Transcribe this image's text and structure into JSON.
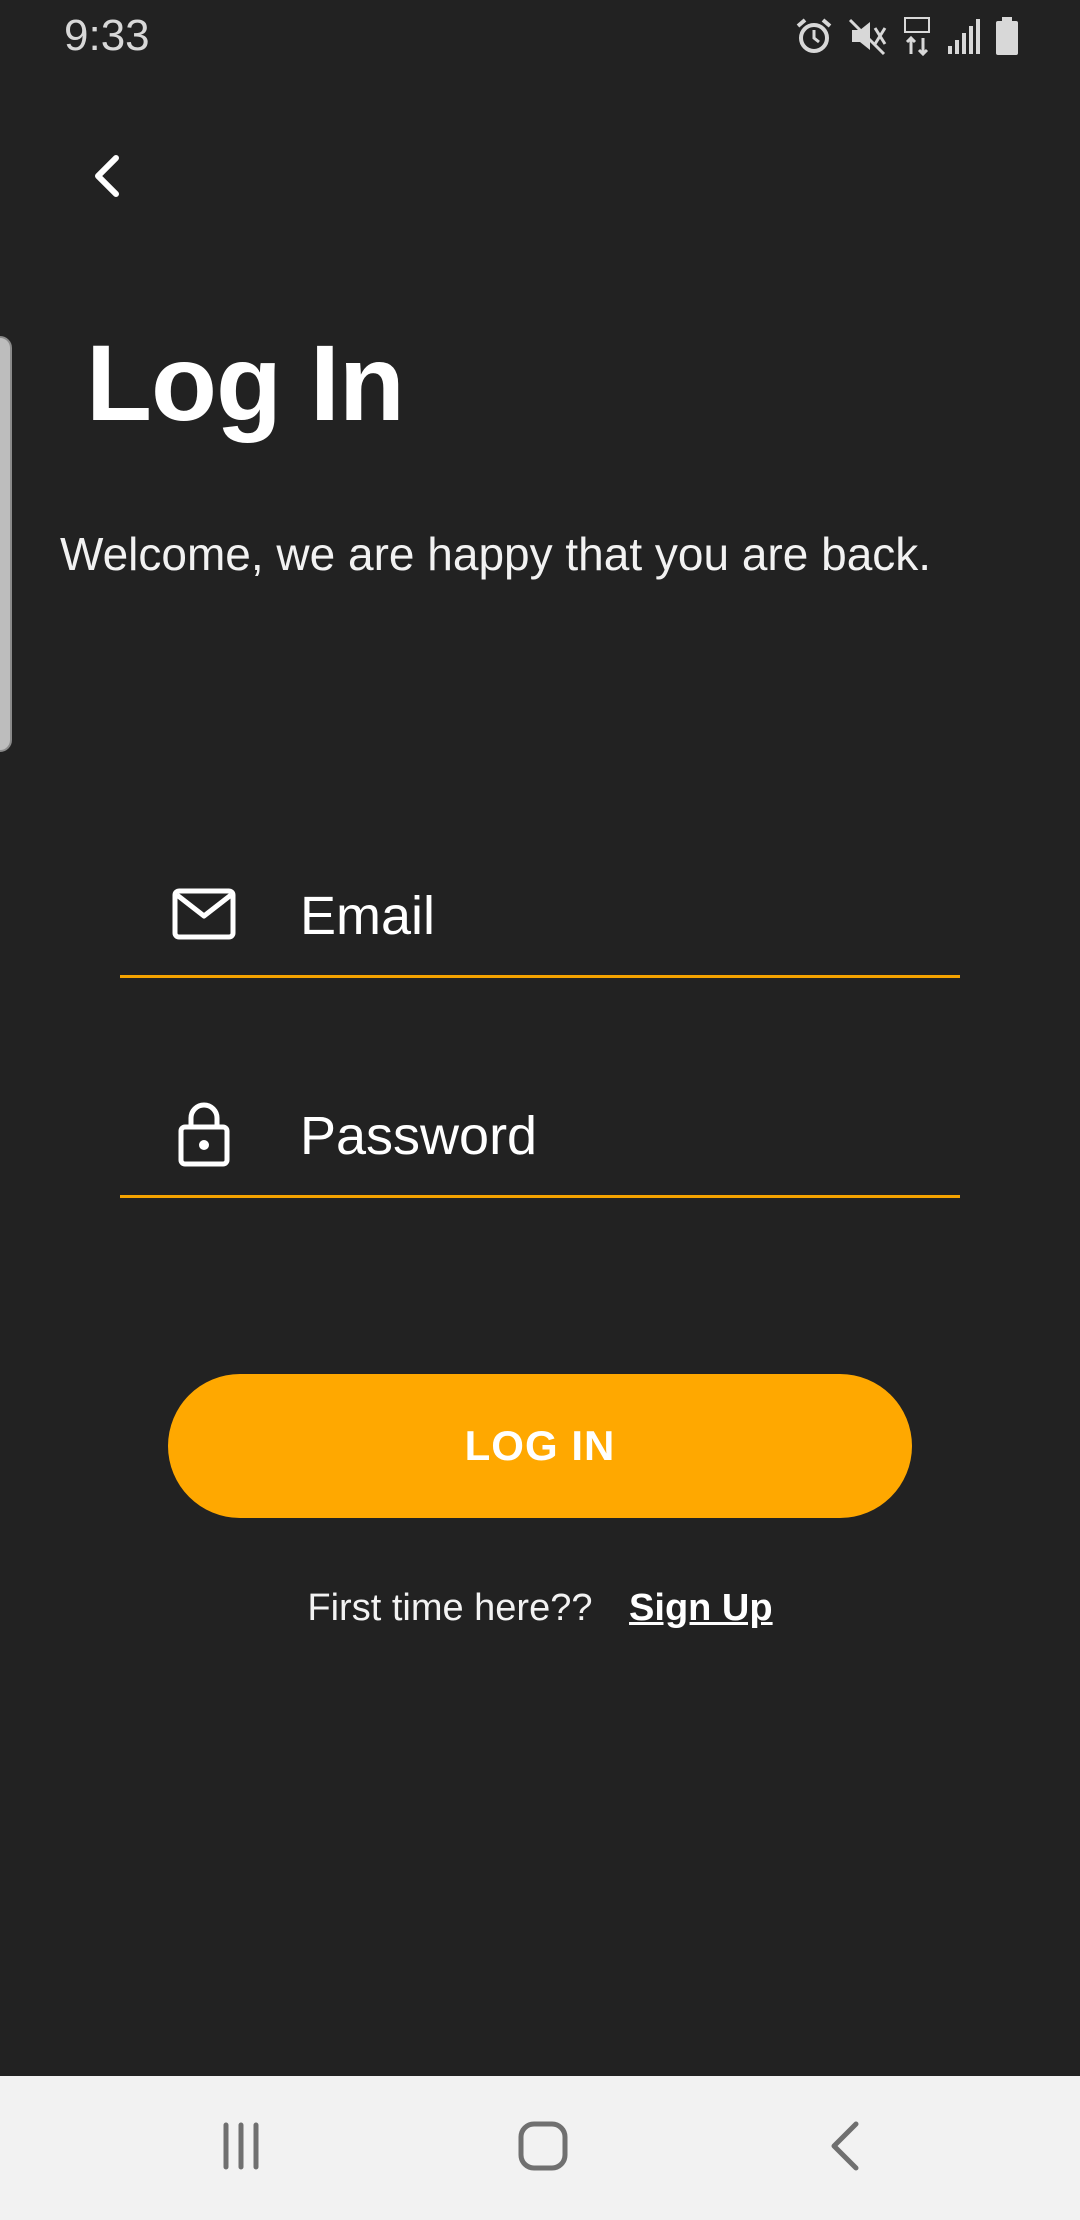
{
  "status_bar": {
    "time": "9:33",
    "icons": [
      "alarm-icon",
      "mute-icon",
      "lte-data-icon",
      "signal-icon",
      "battery-icon"
    ]
  },
  "header": {
    "back_icon": "chevron-left-icon"
  },
  "page": {
    "title": "Log In",
    "subtitle": "Welcome, we are happy that you are back."
  },
  "form": {
    "email": {
      "icon": "mail-icon",
      "placeholder": "Email",
      "value": ""
    },
    "password": {
      "icon": "lock-icon",
      "placeholder": "Password",
      "value": ""
    },
    "submit_label": "LOG IN"
  },
  "signup": {
    "prompt": "First time here??",
    "link_label": "Sign Up"
  },
  "nav_bar": {
    "items": [
      "recents-icon",
      "home-icon",
      "back-icon"
    ]
  },
  "colors": {
    "background": "#222222",
    "accent": "#ffa800",
    "underline": "#f5a300",
    "nav_bar_bg": "#f2f2f2"
  }
}
